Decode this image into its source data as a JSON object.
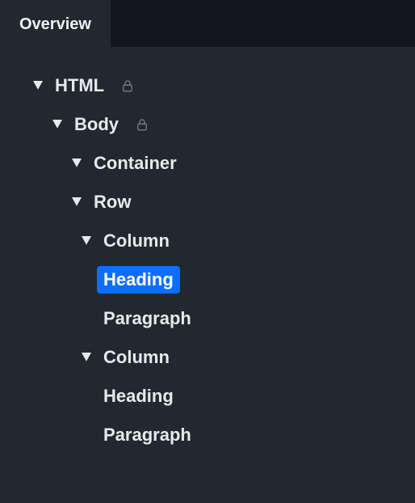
{
  "tabs": {
    "overview": "Overview"
  },
  "tree": {
    "html": {
      "label": "HTML",
      "locked": true
    },
    "body": {
      "label": "Body",
      "locked": true
    },
    "container": {
      "label": "Container"
    },
    "row": {
      "label": "Row"
    },
    "column1": {
      "label": "Column"
    },
    "heading1": {
      "label": "Heading",
      "selected": true
    },
    "paragraph1": {
      "label": "Paragraph"
    },
    "column2": {
      "label": "Column"
    },
    "heading2": {
      "label": "Heading"
    },
    "paragraph2": {
      "label": "Paragraph"
    }
  },
  "colors": {
    "selected": "#0d6efd"
  }
}
